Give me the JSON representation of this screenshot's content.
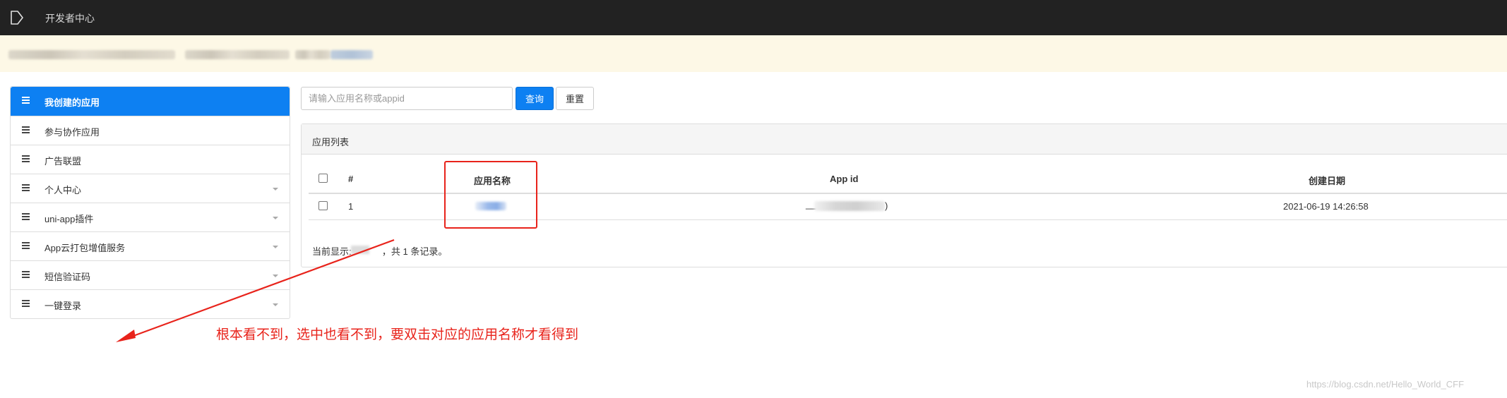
{
  "topbar": {
    "title": "开发者中心"
  },
  "sidebar": {
    "items": [
      {
        "label": "我创建的应用",
        "active": true,
        "has_caret": false
      },
      {
        "label": "参与协作应用",
        "active": false,
        "has_caret": false
      },
      {
        "label": "广告联盟",
        "active": false,
        "has_caret": false
      },
      {
        "label": "个人中心",
        "active": false,
        "has_caret": true
      },
      {
        "label": "uni-app插件",
        "active": false,
        "has_caret": true
      },
      {
        "label": "App云打包增值服务",
        "active": false,
        "has_caret": true
      },
      {
        "label": "短信验证码",
        "active": false,
        "has_caret": true
      },
      {
        "label": "一键登录",
        "active": false,
        "has_caret": true
      }
    ]
  },
  "search": {
    "placeholder": "请输入应用名称或appid",
    "value": "",
    "query_label": "查询",
    "reset_label": "重置"
  },
  "panel": {
    "title": "应用列表",
    "columns": [
      "#",
      "应用名称",
      "App id",
      "创建日期"
    ],
    "rows": [
      {
        "index": "1",
        "name": "",
        "appid_prefix": "__",
        "appid_suffix": ")",
        "created": "2021-06-19 14:26:58"
      }
    ],
    "summary_prefix": "当前显示:",
    "summary_suffix": "，共 1 条记录。"
  },
  "annotation": {
    "text": "根本看不到，选中也看不到，要双击对应的应用名称才看得到",
    "color": "#e8231b"
  },
  "watermark": "https://blog.csdn.net/Hello_World_CFF",
  "colors": {
    "primary": "#0d80f2",
    "topbar": "#222222",
    "notice_bg": "#fdf8e6"
  }
}
